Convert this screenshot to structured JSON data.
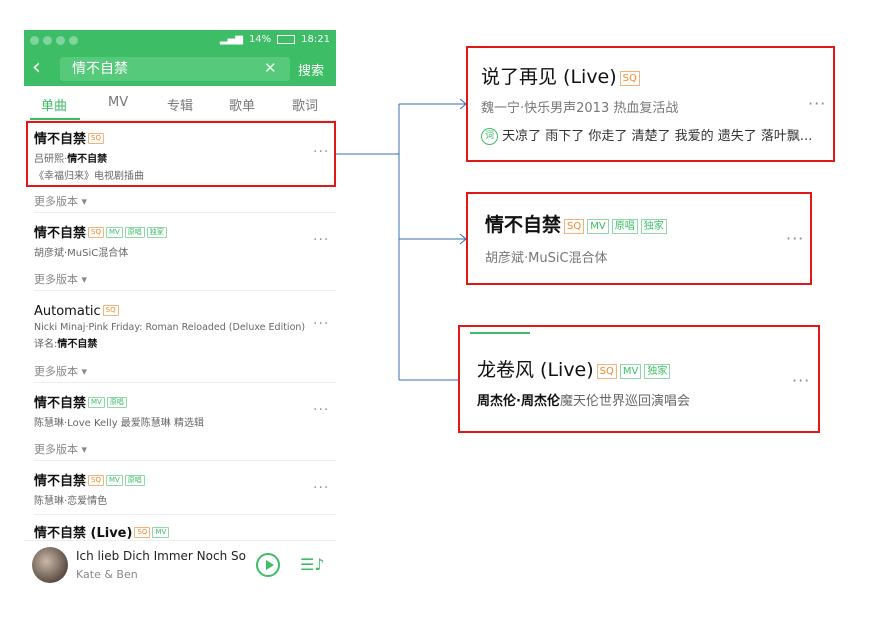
{
  "status": {
    "percent": "14%",
    "time": "18:21"
  },
  "search": {
    "query": "情不自禁",
    "button": "搜索"
  },
  "tabs": [
    "单曲",
    "MV",
    "专辑",
    "歌单",
    "歌词"
  ],
  "results": [
    {
      "title": "情不自禁",
      "sub_a": "吕研熙·",
      "sub_b": "情不自禁",
      "line2": "《幸福归来》电视剧插曲"
    },
    {
      "title": "情不自禁",
      "sub": "胡彦斌·MuSiC混合体"
    },
    {
      "title": "Automatic",
      "sub": "Nicki Minaj·Pink Friday: Roman Reloaded (Deluxe Edition)",
      "alias_a": "译名:",
      "alias_b": "情不自禁"
    },
    {
      "title": "情不自禁",
      "sub": "陈慧琳·Love Kelly 最爱陈慧琳 精选辑"
    },
    {
      "title": "情不自禁",
      "sub": "陈慧琳·恋爱情色"
    },
    {
      "title": "情不自禁 (Live)"
    }
  ],
  "more_versions": "更多版本",
  "tags": {
    "sq": "SQ",
    "mv": "MV",
    "yuanchang": "原唱",
    "dujia": "独家"
  },
  "player": {
    "song": "Ich lieb Dich Immer Noch So...",
    "artist": "Kate & Ben"
  },
  "cards": {
    "c1": {
      "title": "说了再见 (Live)",
      "sub": "魏一宁·快乐男声2013 热血复活战",
      "lyric_badge": "词",
      "lyric": "天凉了 雨下了 你走了 清楚了 我爱的 遗失了 落叶飘..."
    },
    "c2": {
      "title": "情不自禁",
      "sub": "胡彦斌·MuSiC混合体"
    },
    "c3": {
      "title": "龙卷风 (Live)",
      "sub_bold": "周杰伦·周杰伦",
      "sub_rest": "魔天伦世界巡回演唱会"
    }
  },
  "colors": {
    "accent": "#3dbd66",
    "highlight_box": "#e01818",
    "connector": "#3a6bb5"
  }
}
